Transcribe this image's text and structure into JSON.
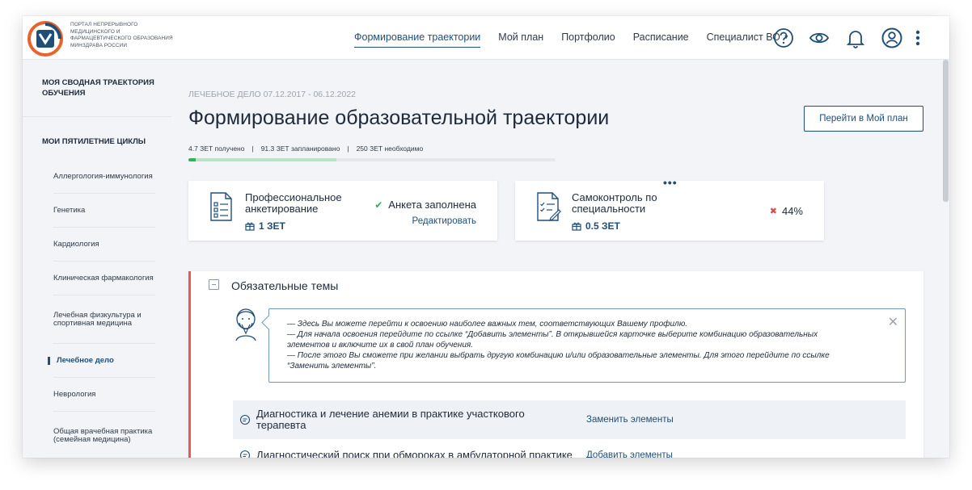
{
  "header": {
    "logo_text": "Портал непрерывного медицинского и фармацевтического образования Минздрава России",
    "nav": [
      {
        "label": "Формирование траектории"
      },
      {
        "label": "Мой план"
      },
      {
        "label": "Портфолио"
      },
      {
        "label": "Расписание"
      },
      {
        "label": "Специалист ВО"
      }
    ],
    "icons": [
      "help-icon",
      "eye-icon",
      "bell-icon",
      "user-icon",
      "more-vertical-icon"
    ]
  },
  "sidebar": {
    "summary_title": "Моя сводная траектория обучения",
    "cycles_title": "Мои пятилетние циклы",
    "items": [
      {
        "label": "Аллергология-иммунология"
      },
      {
        "label": "Генетика"
      },
      {
        "label": "Кардиология"
      },
      {
        "label": "Клиническая фармакология"
      },
      {
        "label": "Лечебная физкультура и спортивная медицина"
      },
      {
        "label": "Лечебное дело"
      },
      {
        "label": "Неврология"
      },
      {
        "label": "Общая врачебная практика (семейная медицина)"
      }
    ]
  },
  "main": {
    "subtitle_prefix": "Лечебное дело",
    "subtitle_dates": "07.12.2017 - 06.12.2022",
    "title": "Формирование образовательной траектории",
    "plan_button": "Перейти в Мой план",
    "stats": {
      "received": "4.7 ЗЕТ получено",
      "planned": "91.3 ЗЕТ запланировано",
      "required": "250 ЗЕТ необходимо"
    },
    "progress": {
      "received_fraction": 0.019,
      "planned_fraction": 0.384
    },
    "cards": [
      {
        "title": "Профессиональное анкетирование",
        "zet": "1 ЗЕТ",
        "status": "Анкета заполнена",
        "action": "Редактировать"
      },
      {
        "title": "Самоконтроль по специальности",
        "zet": "0.5 ЗЕТ",
        "status": "44%",
        "menu": "•••"
      }
    ],
    "topics": {
      "title": "Обязательные темы",
      "hint": [
        "— Здесь Вы можете перейти к освоению наиболее важных тем, соответствующих Вашему профилю.",
        "— Для начала освоения перейдите по ссылке “Добавить элементы”. В открывшейся карточке выберите комбинацию образовательных",
        "элементов и включите их в свой план обучения.",
        "— После этого Вы сможете при желании выбрать другую комбинацию и/или образовательные элементы. Для этого перейдите по ссылке",
        "“Заменить элементы”."
      ],
      "rows": [
        {
          "name": "Диагностика и лечение анемии в практике участкового терапевта",
          "action": "Заменить элементы"
        },
        {
          "name": "Диагностический поиск при обмороках в амбулаторной практике",
          "action": "Добавить элементы"
        }
      ]
    }
  },
  "colors": {
    "accent": "#1f4e79",
    "success": "#2db35a",
    "danger": "#e8585a",
    "logo_orange": "#e8622c"
  }
}
